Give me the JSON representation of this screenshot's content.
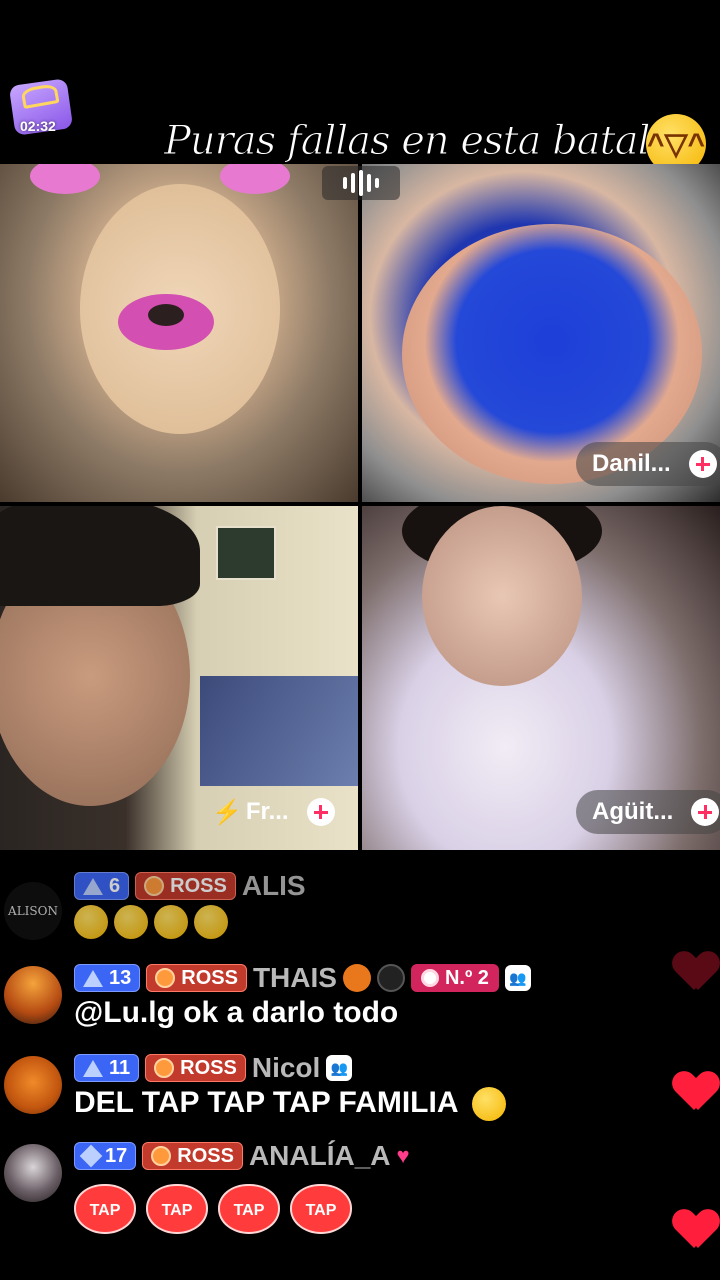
{
  "timer": {
    "time": "02:32"
  },
  "caption": {
    "text": "Puras fallas en esta batalla",
    "emoji": "laughing-face"
  },
  "participants": [
    {
      "name": "",
      "plus": false
    },
    {
      "name": "Danil...",
      "plus": true
    },
    {
      "name": "Fr...",
      "plus": true,
      "icon": "lightning-bolt"
    },
    {
      "name": "Agüit...",
      "plus": true
    }
  ],
  "chat": {
    "messages": [
      {
        "avatar_label": "ALISON",
        "level": "6",
        "level_icon": "triangle",
        "fan_badge": "ROSS",
        "username": "ALIS",
        "text": "",
        "emoji_count": 4,
        "emoji": "laughing-face"
      },
      {
        "level": "13",
        "level_icon": "triangle",
        "fan_badge": "ROSS",
        "username": "THAIS",
        "rank": "N.º 2",
        "text": "@Lu.lg ok a darlo todo"
      },
      {
        "level": "11",
        "level_icon": "triangle",
        "fan_badge": "ROSS",
        "username": "Nicol",
        "text": "DEL TAP TAP TAP FAMILIA"
      },
      {
        "level": "17",
        "level_icon": "diamond",
        "fan_badge": "ROSS",
        "username": "ANALÍA_A",
        "text": "",
        "sticker_label": "TAP",
        "sticker_count": 4
      }
    ]
  },
  "colors": {
    "level_badge": "#3b66f5",
    "fan_badge": "#c23a2c",
    "rank_badge": "#d2255d",
    "heart": "#ff1f3d"
  }
}
